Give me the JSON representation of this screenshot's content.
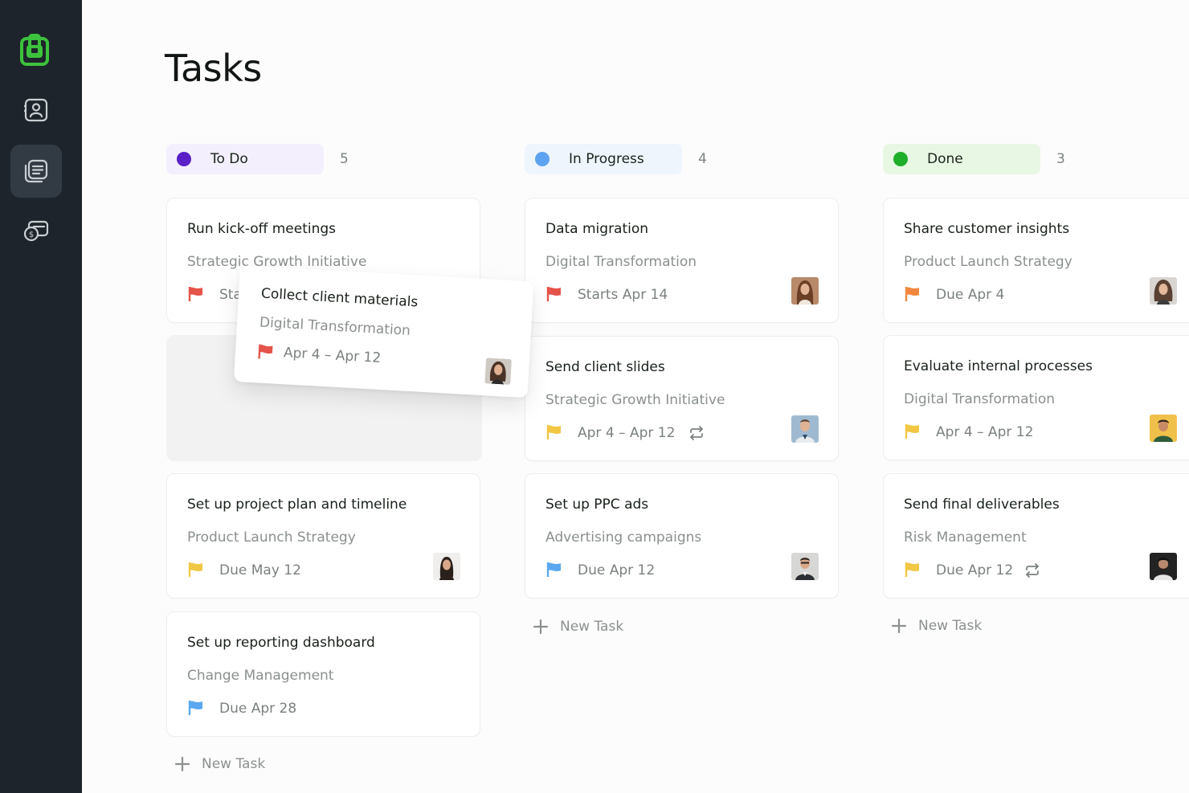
{
  "page": {
    "title": "Tasks"
  },
  "sidebar": {
    "items": [
      {
        "name": "logo-icon"
      },
      {
        "name": "contacts-icon"
      },
      {
        "name": "tasks-icon",
        "active": true
      },
      {
        "name": "billing-icon"
      }
    ]
  },
  "columns": [
    {
      "name": "To Do",
      "count": "5",
      "dot_color": "#5b1fc7",
      "header_bg": "#f3effd",
      "cards": [
        {
          "title": "Run kick-off meetings",
          "project": "Strategic Growth Initiative",
          "date": "Starts Apr 14",
          "flag_color": "#e5534b"
        },
        {
          "title": "Set up project plan and timeline",
          "project": "Product Launch Strategy",
          "date": "Due May 12",
          "flag_color": "#f2c744",
          "avatar": "woman-dark-hair"
        },
        {
          "title": "Set up reporting dashboard",
          "project": "Change Management",
          "date": "Due Apr 28",
          "flag_color": "#5aa8ef"
        }
      ],
      "new_task_label": "New Task"
    },
    {
      "name": "In Progress",
      "count": "4",
      "dot_color": "#5ea3f0",
      "header_bg": "#eef5fd",
      "cards": [
        {
          "title": "Data migration",
          "project": "Digital Transformation",
          "date": "Starts Apr 14",
          "flag_color": "#e5534b",
          "avatar": "woman-brown-hair"
        },
        {
          "title": "Send client slides",
          "project": "Strategic Growth Initiative",
          "date": "Apr 4 – Apr 12",
          "flag_color": "#f2c744",
          "repeat": true,
          "avatar": "man-suit"
        },
        {
          "title": "Set up PPC ads",
          "project": "Advertising campaigns",
          "date": "Due Apr 12",
          "flag_color": "#5aa8ef",
          "avatar": "man-glasses"
        }
      ],
      "new_task_label": "New Task"
    },
    {
      "name": "Done",
      "count": "3",
      "dot_color": "#1fae2a",
      "header_bg": "#e8f7e3",
      "cards": [
        {
          "title": "Share customer insights",
          "project": "Product Launch Strategy",
          "date": "Due Apr 4",
          "flag_color": "#f0883e",
          "avatar": "woman-curly-hair"
        },
        {
          "title": "Evaluate internal processes",
          "project": "Digital Transformation",
          "date": "Apr 4 – Apr 12",
          "flag_color": "#f2c744",
          "avatar": "man-yellow-bg"
        },
        {
          "title": "Send final deliverables",
          "project": "Risk Management",
          "date": "Due Apr 12",
          "flag_color": "#f2c744",
          "repeat": true,
          "avatar": "man-dark-bg"
        }
      ],
      "new_task_label": "New Task"
    }
  ],
  "dragging_card": {
    "title": "Collect client materials",
    "project": "Digital Transformation",
    "date": "Apr 4 – Apr 12",
    "flag_color": "#e5534b",
    "avatar": "woman-smiling"
  }
}
